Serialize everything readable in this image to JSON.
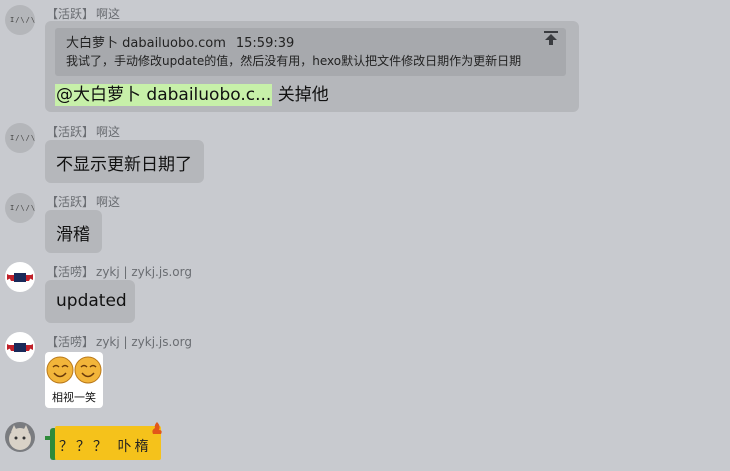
{
  "messages": [
    {
      "tag": "【活跃】",
      "nick": "啊这",
      "quote": {
        "author": "大白萝卜 dabailuobo.com",
        "time": "15:59:39",
        "text": "我试了，手动修改update的值，然后没有用，hexo默认把文件修改日期作为更新日期"
      },
      "mention": "@大白萝卜 dabailuobo.c...",
      "text": "关掉他"
    },
    {
      "tag": "【活跃】",
      "nick": "啊这",
      "text": "不显示更新日期了"
    },
    {
      "tag": "【活跃】",
      "nick": "啊这",
      "text": "滑稽"
    },
    {
      "tag": "【活唠】",
      "nick": "zykj | zykj.js.org",
      "text": "updated"
    },
    {
      "tag": "【活唠】",
      "nick": "zykj | zykj.js.org",
      "sticker_caption": "相视一笑"
    },
    {
      "badge_text": "？？？ 卟楕"
    }
  ],
  "icons": {
    "scroll": "arrow-up-bar-icon"
  },
  "colors": {
    "background": "#c8cacf",
    "bubble": "#b5b7bb",
    "quote": "#a7a9ad",
    "mention": "#c7f0a9",
    "badge": "#f5c21b"
  }
}
